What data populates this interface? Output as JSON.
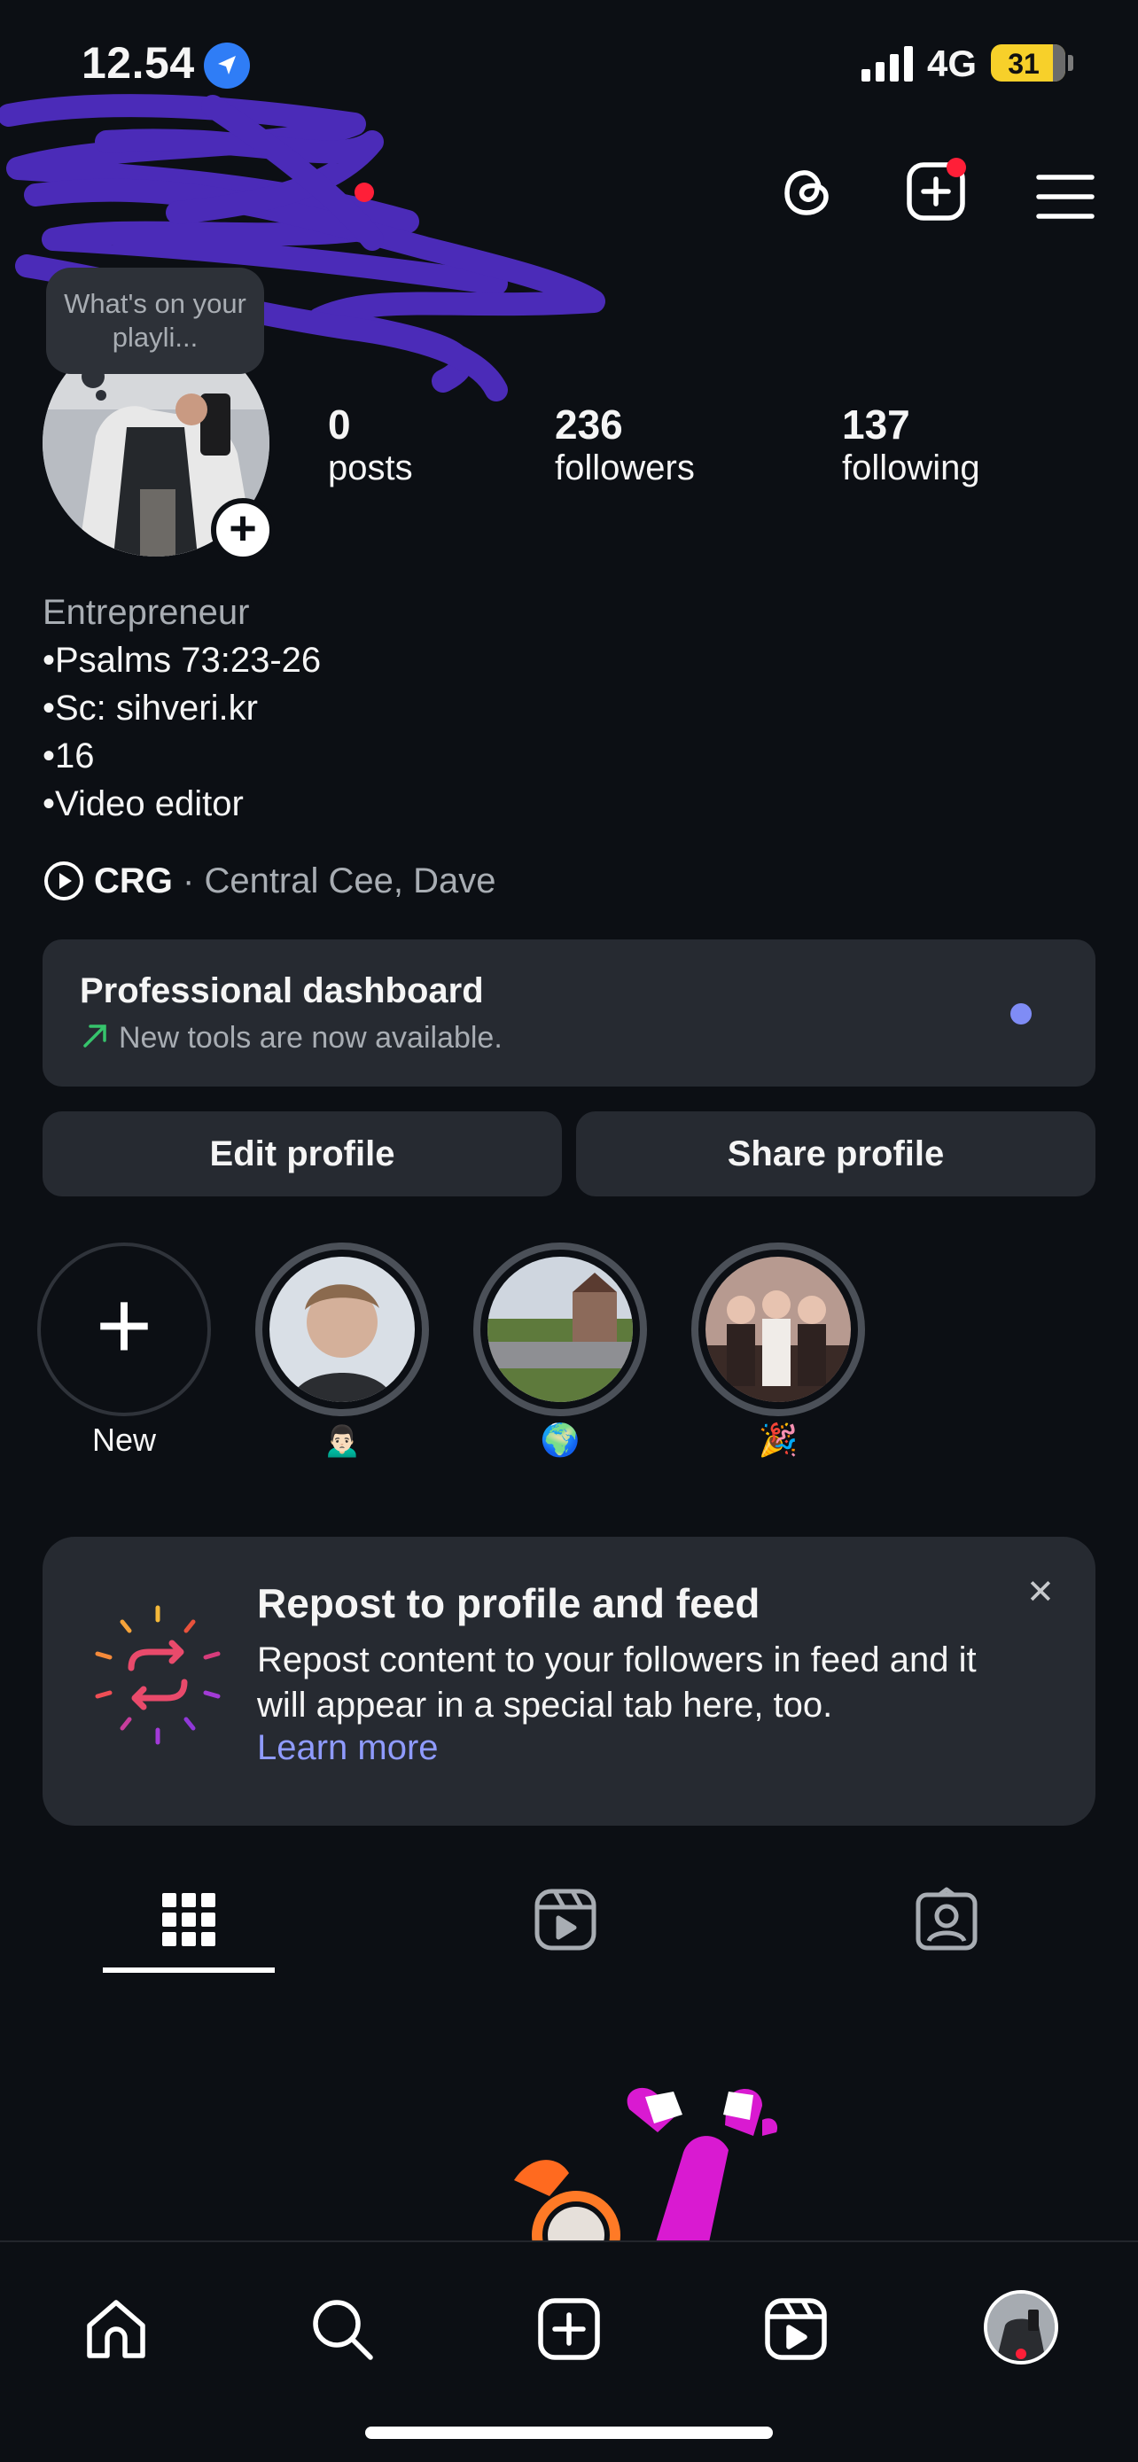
{
  "status_bar": {
    "time": "12.54",
    "network": "4G",
    "battery": "31"
  },
  "profile": {
    "note": "What's on your playli...",
    "stats": [
      {
        "value": "0",
        "label": "posts"
      },
      {
        "value": "236",
        "label": "followers"
      },
      {
        "value": "137",
        "label": "following"
      }
    ],
    "category": "Entrepreneur",
    "bio_lines": [
      "•Psalms 73:23-26",
      "•Sc: sihveri.kr",
      "•16",
      "•Video editor"
    ],
    "music": {
      "artist": "CRG",
      "separator": " · ",
      "song": "Central Cee, Dave"
    }
  },
  "dashboard": {
    "title": "Professional dashboard",
    "subtitle": "New tools are now available."
  },
  "buttons": {
    "edit": "Edit profile",
    "share": "Share profile"
  },
  "highlights": [
    {
      "label": "New"
    },
    {
      "label": "🙍🏻‍♂️"
    },
    {
      "label": "🌍"
    },
    {
      "label": "🎉"
    }
  ],
  "repost_card": {
    "title": "Repost to profile and feed",
    "body": "Repost content to your followers in feed and it will appear in a special tab here, too.",
    "link": "Learn more"
  },
  "tabs": [
    {
      "icon": "grid-icon",
      "selected": true
    },
    {
      "icon": "reels-icon",
      "selected": false
    },
    {
      "icon": "tagged-icon",
      "selected": false
    }
  ],
  "bottom_nav": [
    {
      "icon": "home-icon"
    },
    {
      "icon": "search-icon"
    },
    {
      "icon": "create-icon"
    },
    {
      "icon": "reels-icon"
    },
    {
      "icon": "profile-avatar-icon"
    }
  ],
  "colors": {
    "background": "#0c0f14",
    "card": "#262a31",
    "link": "#8f9bff",
    "notification": "#ff1f38",
    "scribble": "#4b2bb8"
  }
}
